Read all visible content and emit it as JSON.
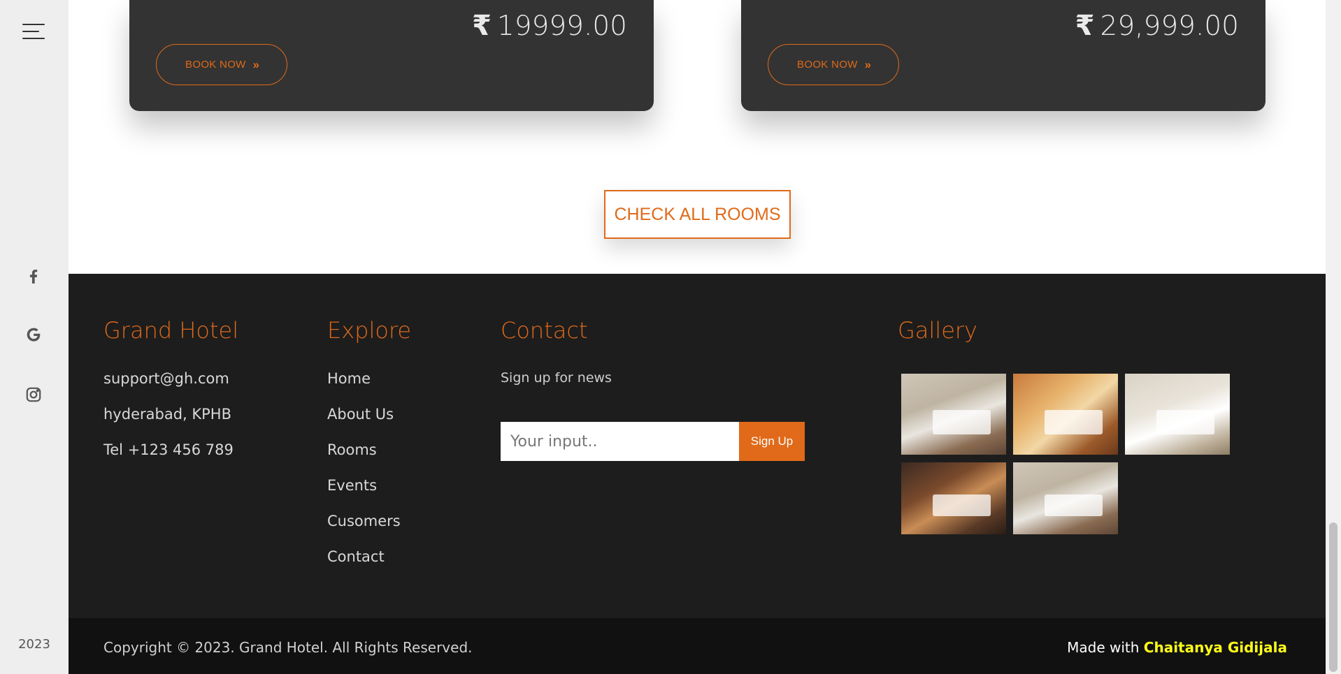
{
  "rail": {
    "year": "2023",
    "social_icons": [
      "facebook-icon",
      "google-icon",
      "instagram-icon"
    ]
  },
  "cards": [
    {
      "price": "19999.00",
      "currency_symbol": "₹",
      "book_label": "BOOK NOW"
    },
    {
      "price": "29,999.00",
      "currency_symbol": "₹",
      "book_label": "BOOK NOW"
    }
  ],
  "check_rooms_label": "CHECK ALL ROOMS",
  "footer": {
    "brand": {
      "title": "Grand Hotel",
      "email": "support@gh.com",
      "address": "hyderabad, KPHB",
      "phone": "Tel +123 456 789"
    },
    "explore": {
      "title": "Explore",
      "links": [
        "Home",
        "About Us",
        "Rooms",
        "Events",
        "Cusomers",
        "Contact"
      ]
    },
    "contact": {
      "title": "Contact",
      "signup_text": "Sign up for news",
      "input_placeholder": "Your input..",
      "button_label": "Sign Up"
    },
    "gallery": {
      "title": "Gallery",
      "image_count": 5
    }
  },
  "bottom": {
    "copyright": "Copyright © 2023. Grand Hotel. All Rights Reserved.",
    "made_with": "Made with",
    "author": "Chaitanya Gidijala"
  },
  "colors": {
    "accent": "#e06a19",
    "footer_bg": "#1d1d1d",
    "card_bg": "#333333",
    "author_highlight": "#ffff1a"
  }
}
